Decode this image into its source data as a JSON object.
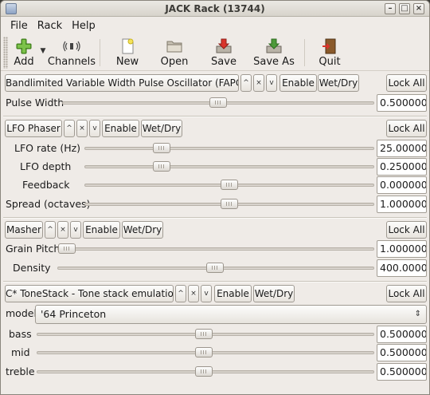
{
  "window": {
    "title": "JACK Rack (13744)",
    "controls": [
      "–",
      "□",
      "×"
    ]
  },
  "menu": [
    "File",
    "Rack",
    "Help"
  ],
  "toolbar": {
    "add": "Add",
    "channels": "Channels",
    "new": "New",
    "open": "Open",
    "save": "Save",
    "save_as": "Save As",
    "quit": "Quit"
  },
  "common": {
    "enable": "Enable",
    "wet_dry": "Wet/Dry",
    "lock_all": "Lock All",
    "up": "^",
    "remove": "×",
    "down": "v"
  },
  "plugins": [
    {
      "name": "Bandlimited Variable Width Pulse Oscillator (FAPC)",
      "controls": [
        {
          "label": "Pulse Width",
          "value": "0.500000",
          "position": 0.5
        }
      ]
    },
    {
      "name": "LFO Phaser",
      "controls": [
        {
          "label": "LFO rate (Hz)",
          "value": "25.000000",
          "position": 0.25
        },
        {
          "label": "LFO depth",
          "value": "0.250000",
          "position": 0.25
        },
        {
          "label": "Feedback",
          "value": "0.000000",
          "position": 0.5
        },
        {
          "label": "Spread (octaves)",
          "value": "1.000000",
          "position": 0.5
        }
      ]
    },
    {
      "name": "Masher",
      "controls": [
        {
          "label": "Grain Pitch",
          "value": "1.000000",
          "position": 0.0
        },
        {
          "label": "Density",
          "value": "400.000000",
          "position": 0.5
        }
      ]
    },
    {
      "name": "C* ToneStack - Tone stack emulation",
      "model_label": "model",
      "model_value": "'64 Princeton",
      "controls": [
        {
          "label": "bass",
          "value": "0.500000",
          "position": 0.5
        },
        {
          "label": "mid",
          "value": "0.500000",
          "position": 0.5
        },
        {
          "label": "treble",
          "value": "0.500000",
          "position": 0.5
        }
      ]
    }
  ]
}
